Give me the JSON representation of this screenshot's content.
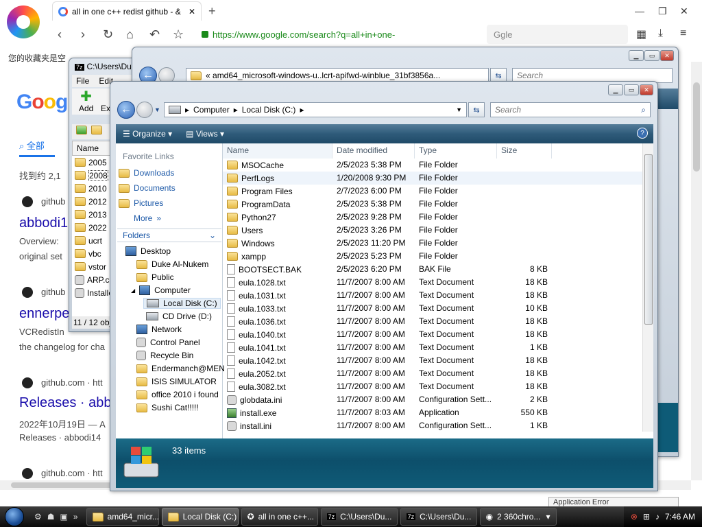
{
  "browser": {
    "tab_title": "all in one c++ redist github - &",
    "url": "https://www.google.com/search?q=all+in+one-",
    "search_engine_placeholder": "Ggle",
    "favorites_bar": "您的收藏夹是空",
    "google_logo": [
      "G",
      "o",
      "o",
      "g"
    ],
    "all_tab": "全部",
    "result_count": "找到约 2,1",
    "results": [
      {
        "site": "github",
        "title": "abbodi1",
        "snippet1": "Overview: ",
        "snippet2": "original set"
      },
      {
        "site": "github",
        "title": "ennerpe",
        "snippet1": "VCRedistIn",
        "snippet2": "the changelog for cha"
      },
      {
        "site": "github.com · htt",
        "title": "Releases · abb",
        "snippet1": "2022年10月19日 — A",
        "snippet2": "Releases · abbodi14"
      },
      {
        "site": "github.com · htt"
      }
    ]
  },
  "zip_window": {
    "title": "C:\\Users\\Du",
    "menu": [
      "File",
      "Edit"
    ],
    "tool_add": "Add",
    "tool_ex": "Ex",
    "col_name": "Name",
    "items": [
      "2005",
      "2008",
      "2010",
      "2012",
      "2013",
      "2022",
      "ucrt",
      "vbc",
      "vstor",
      "ARP.c",
      "Installe"
    ],
    "status": "11 / 12 obj"
  },
  "back_explorer": {
    "address": "amd64_microsoft-windows-u..lcrt-apifwd-winblue_31bf3856a...",
    "search_placeholder": "Search"
  },
  "explorer": {
    "breadcrumb": [
      "Computer",
      "Local Disk (C:)"
    ],
    "search_placeholder": "Search",
    "toolbar": {
      "organize": "Organize",
      "views": "Views"
    },
    "favorite_links_title": "Favorite Links",
    "favorite_links": [
      "Downloads",
      "Documents",
      "Pictures",
      "More"
    ],
    "folders_label": "Folders",
    "tree": [
      {
        "label": "Desktop",
        "icon": "desktop-icon"
      },
      {
        "label": "Duke Al-Nukem",
        "icon": "user-folder-icon"
      },
      {
        "label": "Public",
        "icon": "folder-icon"
      },
      {
        "label": "Computer",
        "icon": "computer-icon"
      },
      {
        "label": "Local Disk (C:)",
        "icon": "drive-icon",
        "selected": true
      },
      {
        "label": "CD Drive (D:)",
        "icon": "cd-drive-icon"
      },
      {
        "label": "Network",
        "icon": "network-icon"
      },
      {
        "label": "Control Panel",
        "icon": "control-panel-icon"
      },
      {
        "label": "Recycle Bin",
        "icon": "recycle-bin-icon"
      },
      {
        "label": "Endermanch@MEN",
        "icon": "folder-icon"
      },
      {
        "label": "ISIS SIMULATOR",
        "icon": "folder-icon"
      },
      {
        "label": "office 2010 i found",
        "icon": "folder-icon"
      },
      {
        "label": "Sushi Cat!!!!!",
        "icon": "folder-icon"
      }
    ],
    "columns": [
      "Name",
      "Date modified",
      "Type",
      "Size"
    ],
    "files": [
      {
        "name": "MSOCache",
        "date": "2/5/2023 5:38 PM",
        "type": "File Folder",
        "size": "",
        "kind": "folder"
      },
      {
        "name": "PerfLogs",
        "date": "1/20/2008 9:30 PM",
        "type": "File Folder",
        "size": "",
        "kind": "folder"
      },
      {
        "name": "Program Files",
        "date": "2/7/2023 6:00 PM",
        "type": "File Folder",
        "size": "",
        "kind": "folder"
      },
      {
        "name": "ProgramData",
        "date": "2/5/2023 5:38 PM",
        "type": "File Folder",
        "size": "",
        "kind": "folder"
      },
      {
        "name": "Python27",
        "date": "2/5/2023 9:28 PM",
        "type": "File Folder",
        "size": "",
        "kind": "folder"
      },
      {
        "name": "Users",
        "date": "2/5/2023 3:26 PM",
        "type": "File Folder",
        "size": "",
        "kind": "folder"
      },
      {
        "name": "Windows",
        "date": "2/5/2023 11:20 PM",
        "type": "File Folder",
        "size": "",
        "kind": "folder"
      },
      {
        "name": "xampp",
        "date": "2/5/2023 5:23 PM",
        "type": "File Folder",
        "size": "",
        "kind": "folder"
      },
      {
        "name": "BOOTSECT.BAK",
        "date": "2/5/2023 6:20 PM",
        "type": "BAK File",
        "size": "8 KB",
        "kind": "file"
      },
      {
        "name": "eula.1028.txt",
        "date": "11/7/2007 8:00 AM",
        "type": "Text Document",
        "size": "18 KB",
        "kind": "file"
      },
      {
        "name": "eula.1031.txt",
        "date": "11/7/2007 8:00 AM",
        "type": "Text Document",
        "size": "18 KB",
        "kind": "file"
      },
      {
        "name": "eula.1033.txt",
        "date": "11/7/2007 8:00 AM",
        "type": "Text Document",
        "size": "10 KB",
        "kind": "file"
      },
      {
        "name": "eula.1036.txt",
        "date": "11/7/2007 8:00 AM",
        "type": "Text Document",
        "size": "18 KB",
        "kind": "file"
      },
      {
        "name": "eula.1040.txt",
        "date": "11/7/2007 8:00 AM",
        "type": "Text Document",
        "size": "18 KB",
        "kind": "file"
      },
      {
        "name": "eula.1041.txt",
        "date": "11/7/2007 8:00 AM",
        "type": "Text Document",
        "size": "1 KB",
        "kind": "file"
      },
      {
        "name": "eula.1042.txt",
        "date": "11/7/2007 8:00 AM",
        "type": "Text Document",
        "size": "18 KB",
        "kind": "file"
      },
      {
        "name": "eula.2052.txt",
        "date": "11/7/2007 8:00 AM",
        "type": "Text Document",
        "size": "18 KB",
        "kind": "file"
      },
      {
        "name": "eula.3082.txt",
        "date": "11/7/2007 8:00 AM",
        "type": "Text Document",
        "size": "18 KB",
        "kind": "file"
      },
      {
        "name": "globdata.ini",
        "date": "11/7/2007 8:00 AM",
        "type": "Configuration Sett...",
        "size": "2 KB",
        "kind": "config"
      },
      {
        "name": "install.exe",
        "date": "11/7/2007 8:03 AM",
        "type": "Application",
        "size": "550 KB",
        "kind": "app"
      },
      {
        "name": "install.ini",
        "date": "11/7/2007 8:00 AM",
        "type": "Configuration Sett...",
        "size": "1 KB",
        "kind": "config"
      }
    ],
    "status_count": "33 items"
  },
  "taskbar": {
    "buttons": [
      {
        "label": "amd64_micr...",
        "active": false
      },
      {
        "label": "Local Disk (C:)",
        "active": true
      },
      {
        "label": "all in one c++...",
        "active": false
      },
      {
        "label": "C:\\Users\\Du...",
        "active": false
      },
      {
        "label": "C:\\Users\\Du...",
        "active": false
      },
      {
        "label": "2 360chro...",
        "active": false
      }
    ],
    "clock": "7:46 AM"
  },
  "notification": "Application Error",
  "colors": {
    "accent": "#1a73e8",
    "link": "#1a0dab",
    "explorer_toolbar": "#2f5b7a",
    "status_bar": "#0d4f6b"
  }
}
